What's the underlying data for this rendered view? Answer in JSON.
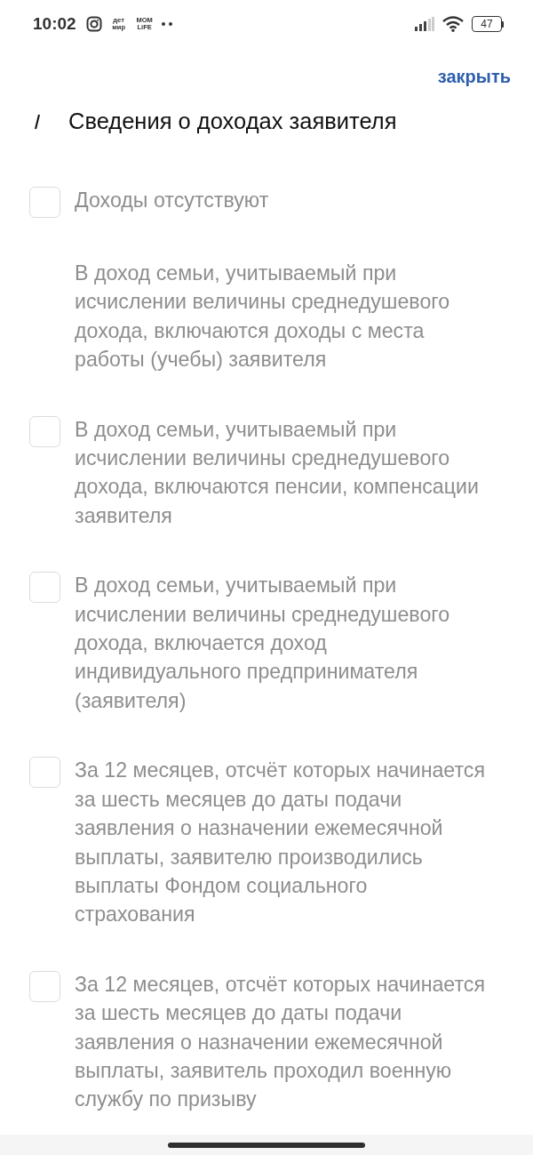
{
  "status_bar": {
    "time": "10:02",
    "notification_icons": [
      {
        "kind": "camera"
      },
      {
        "kind": "logo",
        "text": "дет мир"
      },
      {
        "kind": "logo",
        "text": "MOM LiFE"
      },
      {
        "kind": "more"
      }
    ],
    "battery": "47"
  },
  "header": {
    "close_link": "закрыть"
  },
  "section": {
    "title": "Сведения о доходах заявителя",
    "options": [
      {
        "kind": "checkbox",
        "checked": false,
        "label": "Доходы отсутствуют"
      },
      {
        "kind": "note",
        "label": "В доход семьи, учитываемый при исчислении величины среднедушевого дохода, включаются доходы с места работы (учебы) заявителя"
      },
      {
        "kind": "checkbox",
        "checked": false,
        "label": "В доход семьи, учитываемый при исчислении величины среднедушевого дохода, включаются пенсии, компенсации заявителя"
      },
      {
        "kind": "checkbox",
        "checked": false,
        "label": "В доход семьи, учитываемый при исчислении величины среднедушевого дохода, включается доход индивидуального предпринимателя (заявителя)"
      },
      {
        "kind": "checkbox",
        "checked": false,
        "label": "За 12 месяцев, отсчёт которых начинается за шесть месяцев до даты подачи заявления о назначении ежемесячной выплаты, заявителю производились выплаты Фондом социального страхования"
      },
      {
        "kind": "checkbox",
        "checked": false,
        "label": "За 12 месяцев, отсчёт которых начинается за шесть месяцев до даты подачи заявления о назначении ежемесячной выплаты, заявитель проходил военную службу по призыву"
      }
    ]
  }
}
